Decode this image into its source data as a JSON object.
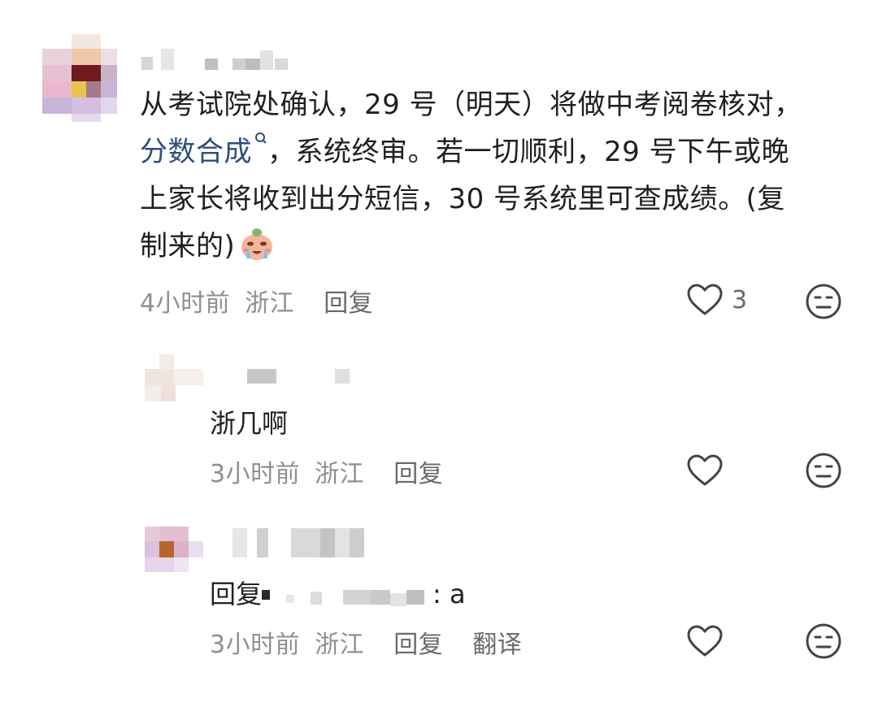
{
  "comments": [
    {
      "text_line1": "从考试院处确认，29 号（明天）将做中考阅卷核对，",
      "link_text": "分数合成",
      "text_line2_rest": "，系统终审。若一切顺利，29 号下午或晚",
      "text_line3": "上家长将收到出分短信，30 号系统里可查成绩。(复",
      "text_line4": "制来的)",
      "time": "4小时前",
      "location": "浙江",
      "reply_label": "回复",
      "likes": "3"
    },
    {
      "text": "浙几啊",
      "time": "3小时前",
      "location": "浙江",
      "reply_label": "回复"
    },
    {
      "reply_prefix": "回复",
      "reply_text": ": a",
      "time": "3小时前",
      "location": "浙江",
      "reply_label": "回复",
      "translate_label": "翻译"
    }
  ]
}
